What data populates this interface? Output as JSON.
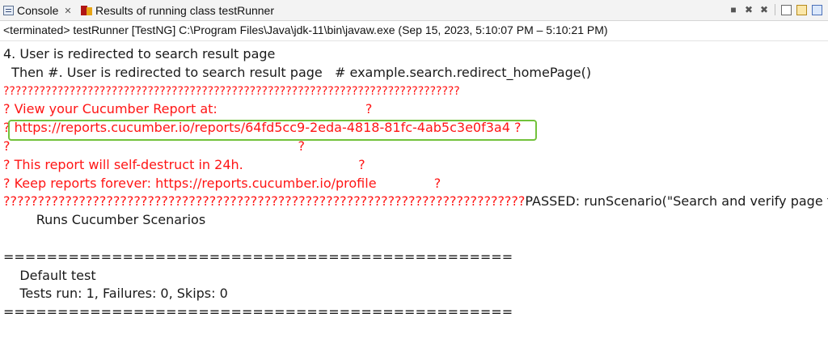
{
  "tabs": [
    {
      "label": "Console",
      "close": "✕"
    },
    {
      "label": "Results of running class testRunner"
    }
  ],
  "toolbar": {
    "icons": [
      "stop-icon",
      "remove-launch-icon",
      "remove-all-icon",
      "clear-console-icon",
      "scroll-lock-icon",
      "word-wrap-icon"
    ]
  },
  "status_line": "<terminated> testRunner [TestNG] C:\\Program Files\\Java\\jdk-11\\bin\\javaw.exe  (Sep 15, 2023, 5:10:07 PM – 5:10:21 PM)",
  "output": {
    "step_title": "4. User is redirected to search result page",
    "step_then": "  Then #. User is redirected to search result page   # example.search.redirect_homePage()",
    "q_border_top": "????????????????????????????????????????????????????????????????????????????",
    "view_report": "? View your Cucumber Report at:                                    ?",
    "report_url_prefix": "? ",
    "report_url": "https://reports.cucumber.io/reports/64fd5cc9-2eda-4818-81fc-4ab5c3e0f3a4",
    "report_url_suffix": " ?",
    "blank_q": "?                                                                      ?",
    "self_destruct": "? This report will self-destruct in 24h.                            ?",
    "keep_reports": "? Keep reports forever: https://reports.cucumber.io/profile              ?",
    "q_border_bottom": "????????????????????????????????????????????????????????????????????????????",
    "passed": "PASSED: runScenario(\"Search and verify page title\", ",
    "runs_cucumber": "        Runs Cucumber Scenarios",
    "empty": " ",
    "eq_line_1": "===============================================",
    "default_test": "    Default test",
    "tests_run": "    Tests run: 1, Failures: 0, Skips: 0",
    "eq_line_2": "==============================================="
  },
  "colors": {
    "stderr": "#ff1515",
    "stdout": "#1a1a1a",
    "highlight": "#72c23b"
  }
}
